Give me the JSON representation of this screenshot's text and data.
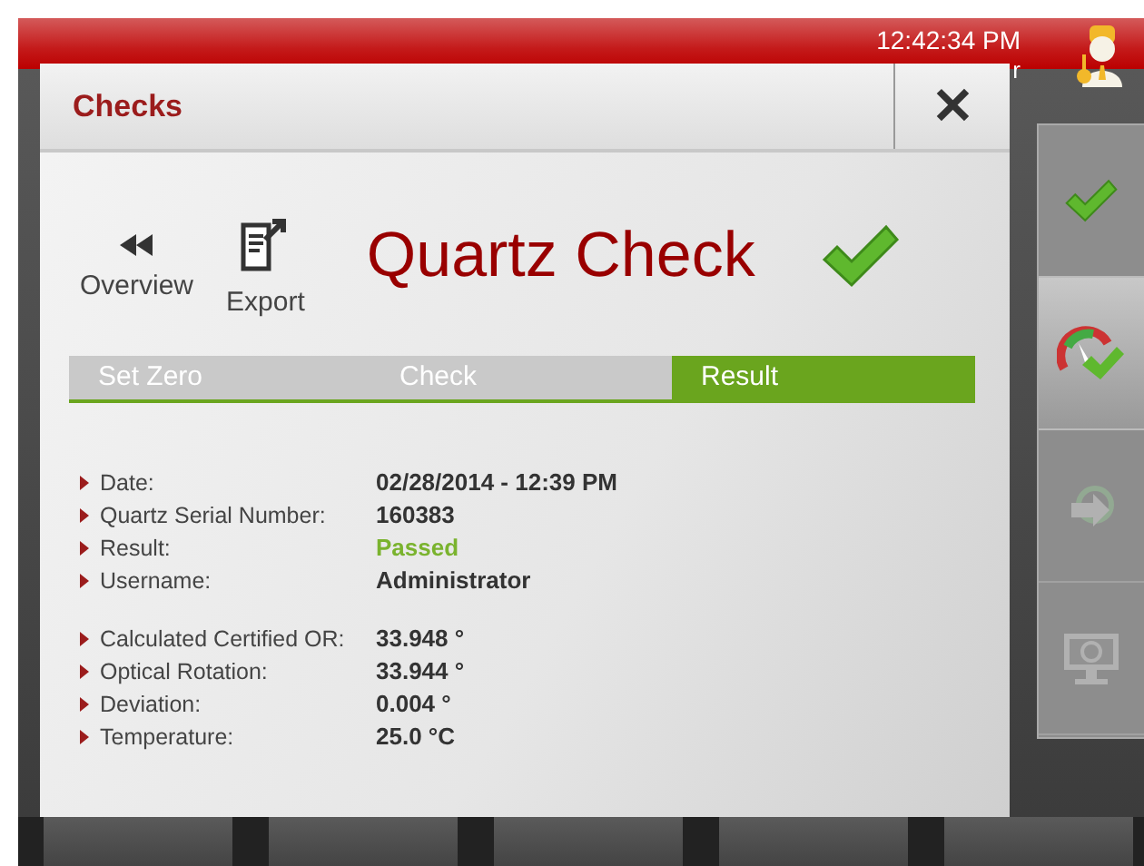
{
  "status_bar": {
    "time": "12:42:34 PM",
    "label_fragment": "r"
  },
  "sidebar": {
    "items": [
      {
        "kind": "check",
        "selected": false,
        "disabled": false
      },
      {
        "kind": "gauge",
        "selected": true,
        "disabled": false
      },
      {
        "kind": "sync",
        "selected": false,
        "disabled": true
      },
      {
        "kind": "monitor",
        "selected": false,
        "disabled": true
      }
    ]
  },
  "dialog": {
    "title": "Checks",
    "close": "✕",
    "toolbar": [
      {
        "kind": "back",
        "label": "Overview"
      },
      {
        "kind": "export",
        "label": "Export"
      }
    ],
    "heading": "Quartz Check",
    "passed": true,
    "steps": [
      {
        "label": "Set Zero",
        "selected": false
      },
      {
        "label": "Check",
        "selected": false
      },
      {
        "label": "Result",
        "selected": true
      }
    ],
    "groups": [
      [
        {
          "label": "Date:",
          "value": "02/28/2014 - 12:39 PM"
        },
        {
          "label": "Quartz Serial Number:",
          "value": "160383"
        },
        {
          "label": "Result:",
          "value": "Passed",
          "color": "#7ab32e"
        },
        {
          "label": "Username:",
          "value": "Administrator"
        }
      ],
      [
        {
          "label": "Calculated Certified OR:",
          "value": "33.948 °"
        },
        {
          "label": "Optical Rotation:",
          "value": "33.944 °"
        },
        {
          "label": "Deviation:",
          "value": "0.004 °"
        },
        {
          "label": "Temperature:",
          "value": "25.0 °C"
        }
      ]
    ]
  }
}
